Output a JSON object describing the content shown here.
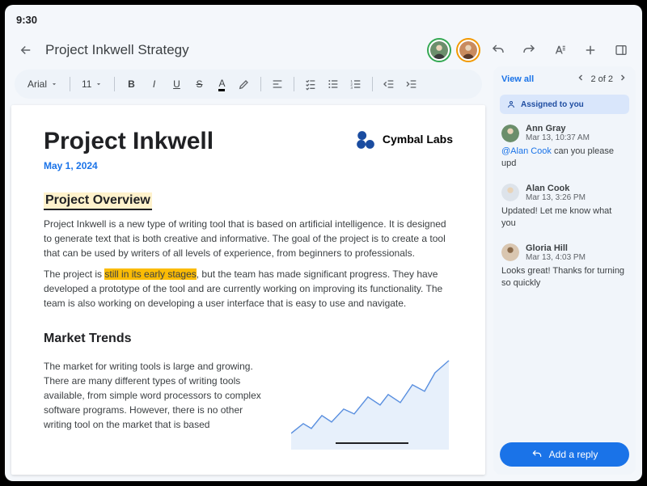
{
  "statusbar": {
    "time": "9:30"
  },
  "header": {
    "title": "Project Inkwell Strategy",
    "collaborators": [
      {
        "name": "Ann Gray",
        "color": "#6b8e6b"
      },
      {
        "name": "Alan Cook",
        "color": "#c98b5e"
      }
    ],
    "actions": [
      "undo",
      "redo",
      "font-format",
      "add",
      "panel"
    ]
  },
  "toolbar": {
    "font": "Arial",
    "size": "11",
    "buttons": [
      "bold",
      "italic",
      "underline",
      "strikethrough",
      "text-color",
      "highlight",
      "align",
      "checklist",
      "bulleted-list",
      "numbered-list",
      "indent-decrease",
      "indent-increase"
    ]
  },
  "document": {
    "title": "Project Inkwell",
    "date": "May 1, 2024",
    "brand": "Cymbal Labs",
    "h_overview": "Project Overview",
    "p_overview": "Project Inkwell is a new type of writing tool that is based on artificial intelligence. It is designed to generate text that is both creative and informative. The goal of the project is to create a tool that can be used by writers of all levels of experience, from beginners to professionals.",
    "p_overview2_a": "The project is ",
    "p_overview2_hl": "still in its early stages",
    "p_overview2_b": ", but the team has made significant progress. They have developed a prototype of the tool and are currently working on improving its functionality. The team is also working on developing a user interface that is easy to use and navigate.",
    "h_trends": "Market Trends",
    "p_trends": "The market for writing tools is large and growing. There are many different types of writing tools available, from simple word processors to complex software programs. However, there is no other writing tool on the market that is based"
  },
  "chart_data": {
    "type": "line",
    "title": "",
    "xlabel": "",
    "ylabel": "",
    "x": [
      0,
      10,
      20,
      30,
      40,
      50,
      60,
      70,
      80,
      90,
      100
    ],
    "values": [
      20,
      28,
      24,
      35,
      30,
      42,
      38,
      55,
      48,
      70,
      90
    ],
    "ylim": [
      0,
      100
    ]
  },
  "sidepanel": {
    "view_all": "View all",
    "pager": "2 of 2",
    "assigned": "Assigned to you",
    "reply": "Add a reply",
    "comments": [
      {
        "name": "Ann Gray",
        "time": "Mar 13, 10:37 AM",
        "mention": "@Alan Cook",
        "text": " can you please upd"
      },
      {
        "name": "Alan Cook",
        "time": "Mar 13, 3:26 PM",
        "text": "Updated! Let me know what you"
      },
      {
        "name": "Gloria Hill",
        "time": "Mar 13, 4:03 PM",
        "text": "Looks great! Thanks for turning so quickly"
      }
    ]
  }
}
